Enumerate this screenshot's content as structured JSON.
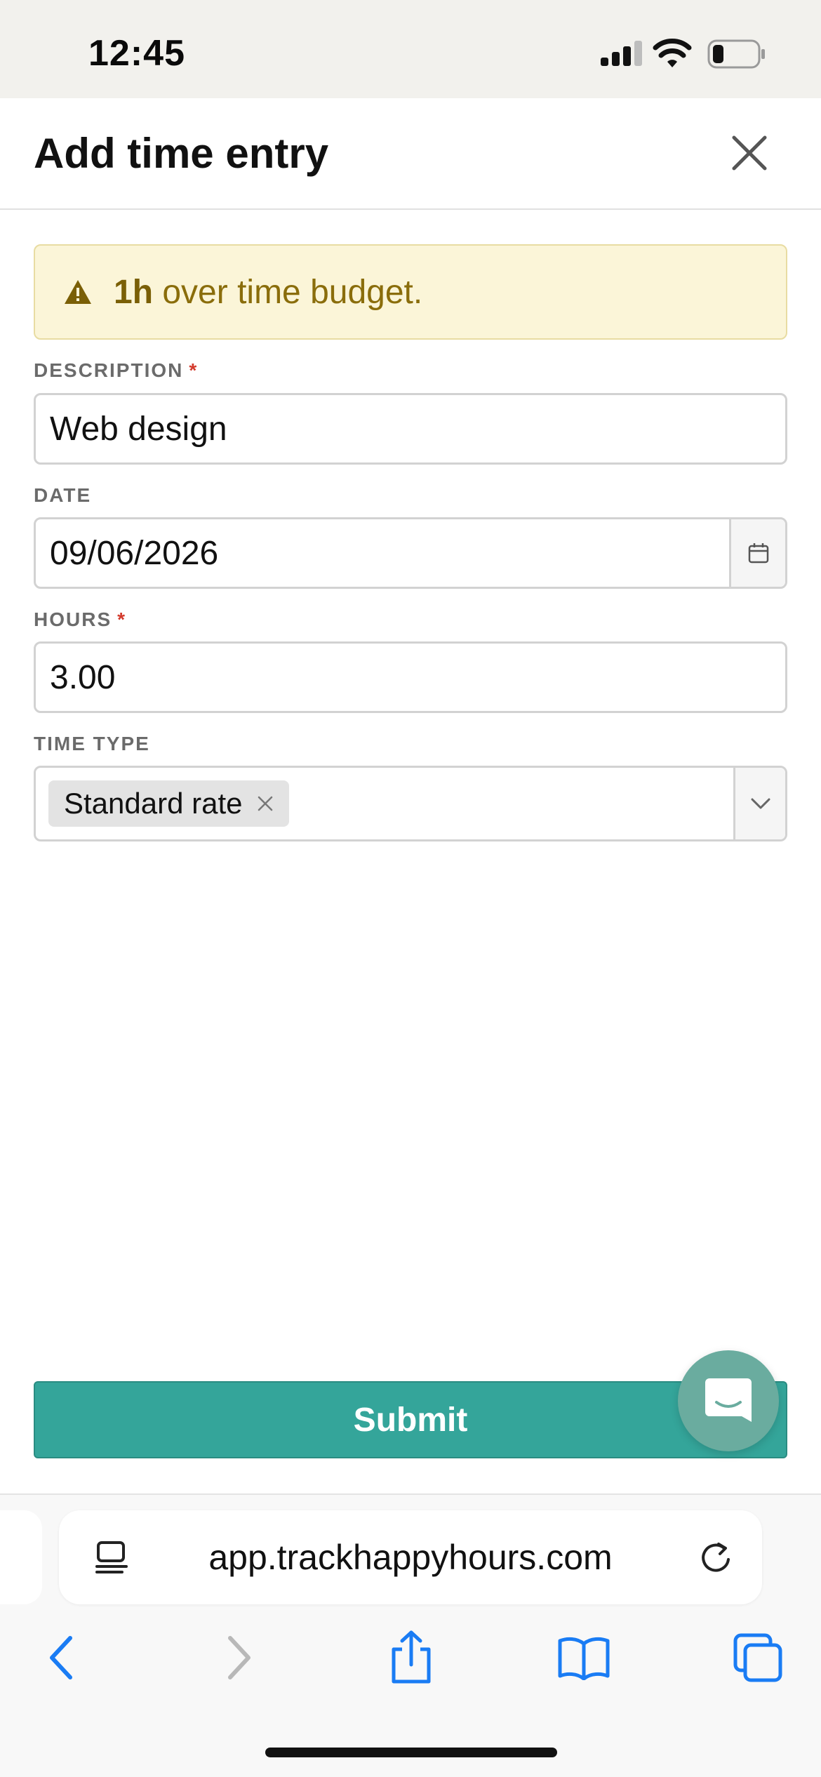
{
  "status_bar": {
    "time": "12:45",
    "battery_level": 0.25
  },
  "modal": {
    "title": "Add time entry",
    "close_icon": "close-icon"
  },
  "alert": {
    "icon": "warning-icon",
    "amount": "1h",
    "message": " over time budget."
  },
  "form": {
    "description": {
      "label": "DESCRIPTION",
      "required_mark": "*",
      "value": "Web design"
    },
    "date": {
      "label": "DATE",
      "value": "09/06/2026",
      "icon": "calendar-icon"
    },
    "hours": {
      "label": "HOURS",
      "required_mark": "*",
      "value": "3.00"
    },
    "time_type": {
      "label": "TIME TYPE",
      "selected": "Standard rate",
      "remove_icon": "close-icon",
      "dropdown_icon": "chevron-down-icon"
    },
    "submit_label": "Submit"
  },
  "chat_button": {
    "icon": "chat-icon"
  },
  "browser": {
    "url": "app.trackhappyhours.com",
    "icons": [
      "reader-icon",
      "reload-icon",
      "back-icon",
      "forward-icon",
      "share-icon",
      "bookmarks-icon",
      "tabs-icon"
    ]
  },
  "colors": {
    "accent": "#34a59a",
    "alert_bg": "#fbf5d8",
    "alert_text": "#8a6d0b",
    "required": "#d33a2c",
    "ios_blue": "#1a7cf4"
  }
}
